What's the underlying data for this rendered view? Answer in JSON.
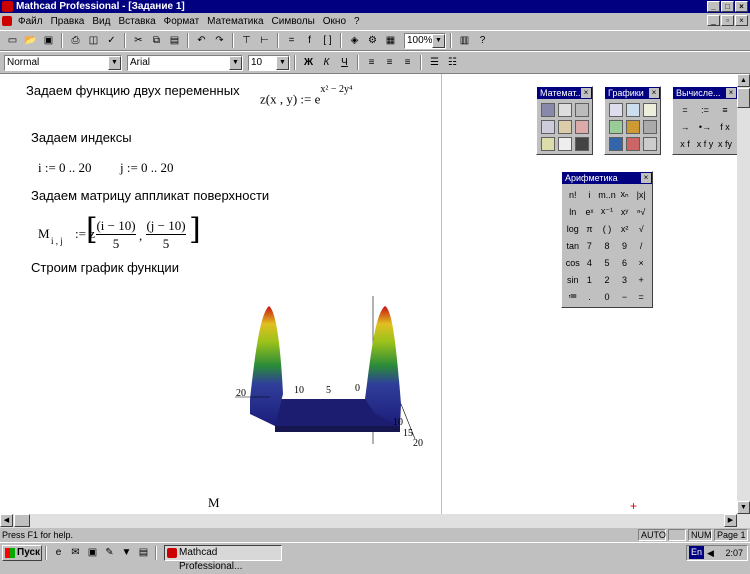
{
  "window": {
    "title": "Mathcad Professional - [Задание 1]"
  },
  "menu": [
    "Файл",
    "Правка",
    "Вид",
    "Вставка",
    "Формат",
    "Математика",
    "Символы",
    "Окно",
    "?"
  ],
  "toolbar": {
    "zoom": "100%"
  },
  "format_bar": {
    "style": "Normal",
    "font": "Arial",
    "size": "10",
    "bold": "Ж",
    "italic": "К",
    "underline": "Ч"
  },
  "document": {
    "text1": "Задаем функцию двух переменных",
    "func_def": "z(x , y) := e",
    "func_exp": "x² − 2y⁴",
    "text2": "Задаем индексы",
    "idx_i": "i := 0 .. 20",
    "idx_j": "j := 0 .. 20",
    "text3": "Задаем матрицу аппликат поверхности",
    "matrix_lhs": "M",
    "matrix_sub": "i , j",
    "matrix_assign": ":= z",
    "frac1_num": "(i − 10)",
    "frac1_den": "5",
    "frac2_num": "(j − 10)",
    "frac2_den": "5",
    "text4": "Строим график функции",
    "plot_label": "M",
    "plot_ticks": {
      "x_20": "20",
      "x_10": "10",
      "x_5": "5",
      "x_0": "0",
      "y_10": "10",
      "y_15": "15",
      "y_20": "20"
    }
  },
  "palettes": {
    "math": {
      "title": "Математ..."
    },
    "graphs": {
      "title": "Графики"
    },
    "calc": {
      "title": "Вычисле...",
      "cells": [
        "=",
        ":=",
        "≡",
        "→",
        "•→",
        "f x",
        "x f",
        "x f y",
        "x fy"
      ]
    },
    "arith": {
      "title": "Арифметика",
      "cells": [
        "n!",
        "i",
        "m..n",
        "xₙ",
        "|x|",
        "ln",
        "eˣ",
        "x⁻¹",
        "xʸ",
        "ⁿ√",
        "log",
        "π",
        "( )",
        "x²",
        "√",
        "tan",
        "7",
        "8",
        "9",
        "/",
        "cos",
        "4",
        "5",
        "6",
        "×",
        "sin",
        "1",
        "2",
        "3",
        "+",
        "≔",
        ".",
        "0",
        "−",
        "="
      ]
    }
  },
  "status": {
    "help": "Press F1 for help.",
    "auto": "AUTO",
    "num": "NUM",
    "page": "Page 1"
  },
  "taskbar": {
    "start": "Пуск",
    "task": "Mathcad Professional...",
    "lang": "En",
    "clock": "2:07"
  }
}
